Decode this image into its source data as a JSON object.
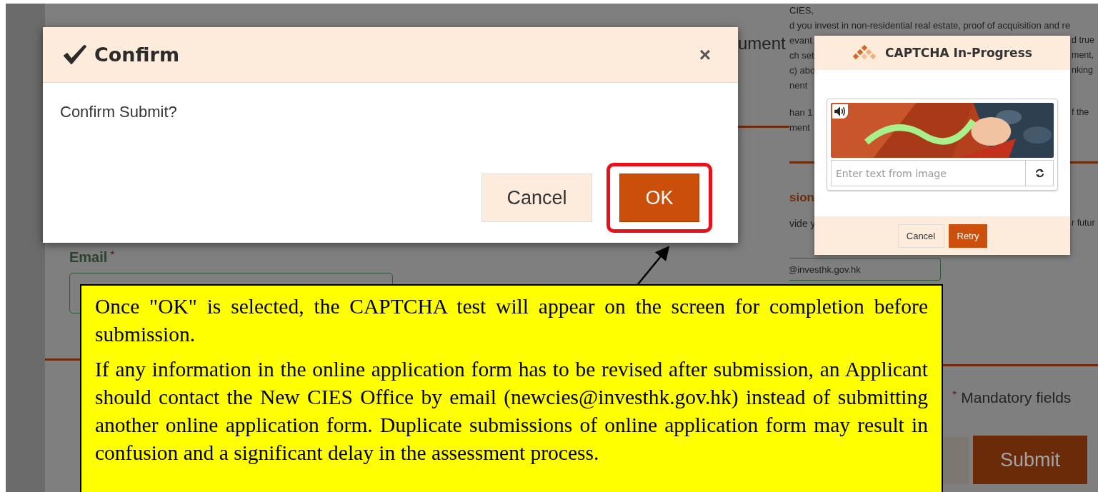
{
  "background_form": {
    "heading_fragment": "ument",
    "email_label": "Email",
    "required_mark": "*",
    "right_lines": [
      {
        "left": "CIES,"
      },
      {
        "left": "d you invest in non-residential real estate, proof of acquisition and re"
      },
      {
        "left": "evant",
        "right": "d true"
      },
      {
        "left": "ch set",
        "right": "ment,"
      },
      {
        "left": "c) abo",
        "right": "nking"
      },
      {
        "left": "nent"
      },
      {
        "left": "han 1",
        "right": "f the"
      },
      {
        "left": "ment"
      }
    ],
    "section_heading": "sion",
    "hint_left": "vide y",
    "hint_right": "r futur",
    "email_value": "@investhk.gov.hk",
    "mandatory_mark": "*",
    "mandatory_note": "Mandatory fields",
    "submit": "Submit"
  },
  "confirm_dialog": {
    "title": "Confirm",
    "close": "×",
    "message": "Confirm Submit?",
    "buttons": [
      {
        "label": "Cancel",
        "kind": "secondary",
        "highlighted": false
      },
      {
        "label": "OK",
        "kind": "primary",
        "highlighted": true
      }
    ]
  },
  "captcha_dialog": {
    "title": "CAPTCHA In-Progress",
    "placeholder": "Enter text from image",
    "buttons": [
      {
        "label": "Cancel",
        "kind": "secondary"
      },
      {
        "label": "Retry",
        "kind": "primary"
      }
    ]
  },
  "callout": {
    "paragraphs": [
      "Once \"OK\" is selected, the CAPTCHA test will appear on the screen for completion before submission.",
      "If any information in the online application form has to be revised after submission, an Applicant should contact the New CIES Office by email (newcies@investhk.gov.hk) instead of submitting another online application form.  Duplicate submissions of online application form may result in confusion and a significant delay in the assessment process."
    ]
  }
}
